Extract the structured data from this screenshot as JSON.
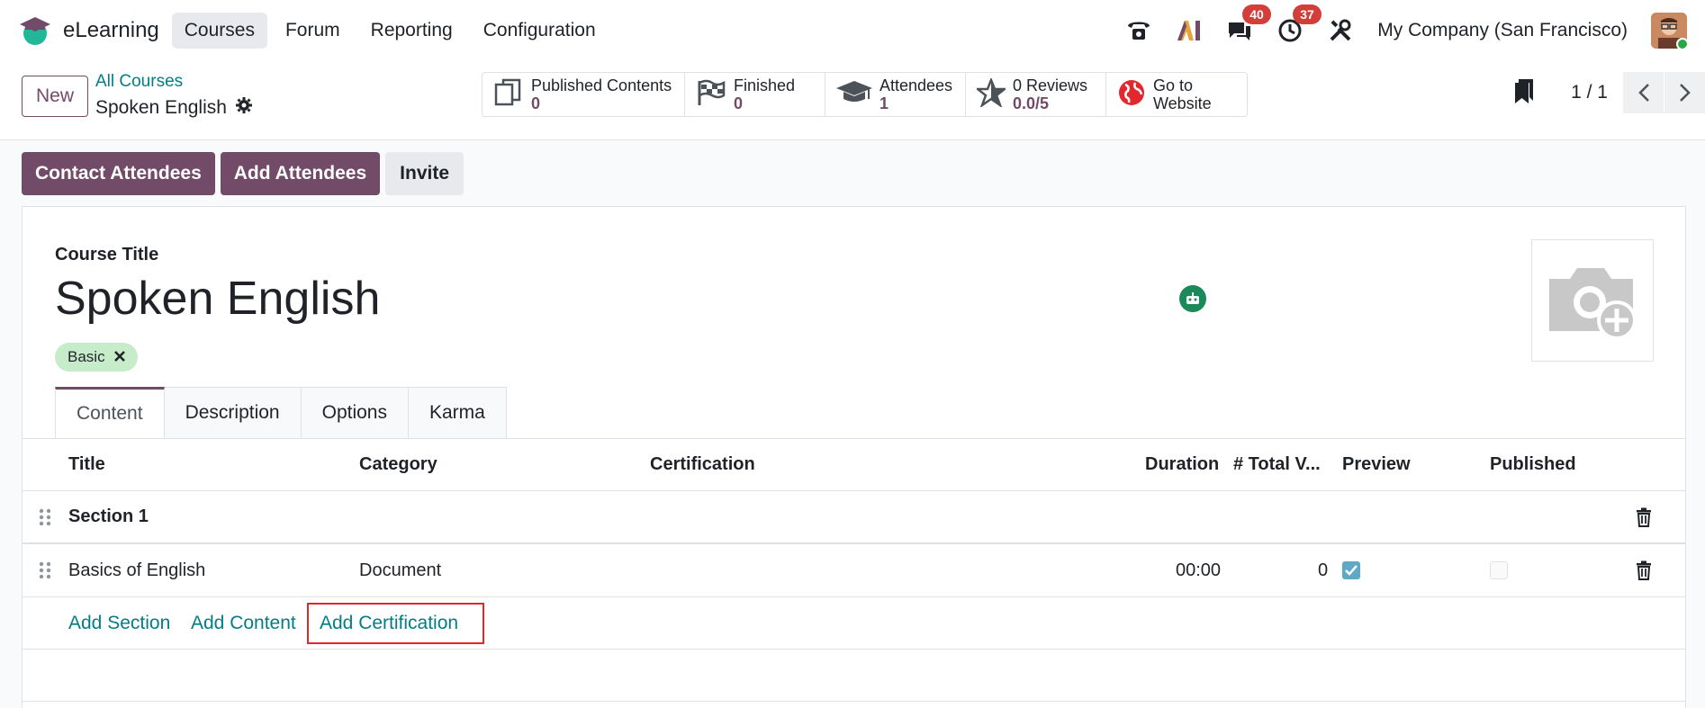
{
  "navbar": {
    "app_name": "eLearning",
    "menu": [
      "Courses",
      "Forum",
      "Reporting",
      "Configuration"
    ],
    "active_menu": "Courses",
    "messages_count": "40",
    "activities_count": "37",
    "company": "My Company (San Francisco)"
  },
  "control": {
    "new_label": "New",
    "breadcrumb_parent": "All Courses",
    "breadcrumb_current": "Spoken English",
    "stats": [
      {
        "label": "Published Contents",
        "value": "0",
        "icon": "documents-icon"
      },
      {
        "label": "Finished",
        "value": "0",
        "icon": "flag-icon"
      },
      {
        "label": "Attendees",
        "value": "1",
        "icon": "graduation-cap-icon"
      },
      {
        "label": "0 Reviews",
        "value": "0.0/5",
        "icon": "star-icon"
      },
      {
        "label": "Go to",
        "value": "Website",
        "icon": "globe-icon"
      }
    ],
    "pager": "1 / 1"
  },
  "actions": {
    "contact": "Contact Attendees",
    "add": "Add Attendees",
    "invite": "Invite"
  },
  "form": {
    "title_label": "Course Title",
    "title": "Spoken English",
    "tag": "Basic",
    "tabs": [
      "Content",
      "Description",
      "Options",
      "Karma"
    ],
    "active_tab": "Content"
  },
  "table": {
    "headers": {
      "title": "Title",
      "category": "Category",
      "certification": "Certification",
      "duration": "Duration",
      "total_views": "# Total V...",
      "preview": "Preview",
      "published": "Published"
    },
    "section": "Section 1",
    "rows": [
      {
        "title": "Basics of English",
        "category": "Document",
        "certification": "",
        "duration": "00:00",
        "views": "0",
        "preview": true,
        "published": false
      }
    ],
    "add_section": "Add Section",
    "add_content": "Add Content",
    "add_certification": "Add Certification"
  },
  "colors": {
    "brand": "#714b67",
    "link": "#017e84",
    "highlight": "#e0282e"
  }
}
